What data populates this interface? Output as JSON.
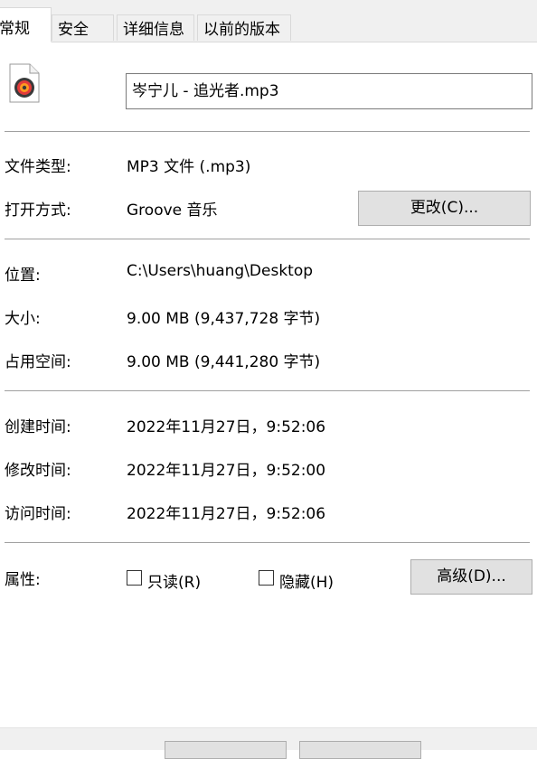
{
  "tabs": [
    "常规",
    "安全",
    "详细信息",
    "以前的版本"
  ],
  "file_name": "岑宁儿 - 追光者.mp3",
  "rows": {
    "file_type": {
      "label": "文件类型:",
      "value": "MP3 文件 (.mp3)"
    },
    "opens_with": {
      "label": "打开方式:",
      "value": "Groove 音乐",
      "button": "更改(C)..."
    },
    "location": {
      "label": "位置:",
      "value": "C:\\Users\\huang\\Desktop"
    },
    "size": {
      "label": "大小:",
      "value": "9.00 MB (9,437,728 字节)"
    },
    "size_on_disk": {
      "label": "占用空间:",
      "value": "9.00 MB (9,441,280 字节)"
    },
    "created": {
      "label": "创建时间:",
      "value": "2022年11月27日，9:52:06"
    },
    "modified": {
      "label": "修改时间:",
      "value": "2022年11月27日，9:52:00"
    },
    "accessed": {
      "label": "访问时间:",
      "value": "2022年11月27日，9:52:06"
    }
  },
  "attributes": {
    "label": "属性:",
    "readonly_label": "只读(R)",
    "readonly_checked": false,
    "hidden_label": "隐藏(H)",
    "hidden_checked": false,
    "advanced_button": "高级(D)..."
  },
  "icons": {
    "file": "music-file-icon"
  },
  "colors": {
    "window_bg": "#f0f0f0",
    "button_bg": "#e1e1e1",
    "divider": "#a0a0a0"
  }
}
